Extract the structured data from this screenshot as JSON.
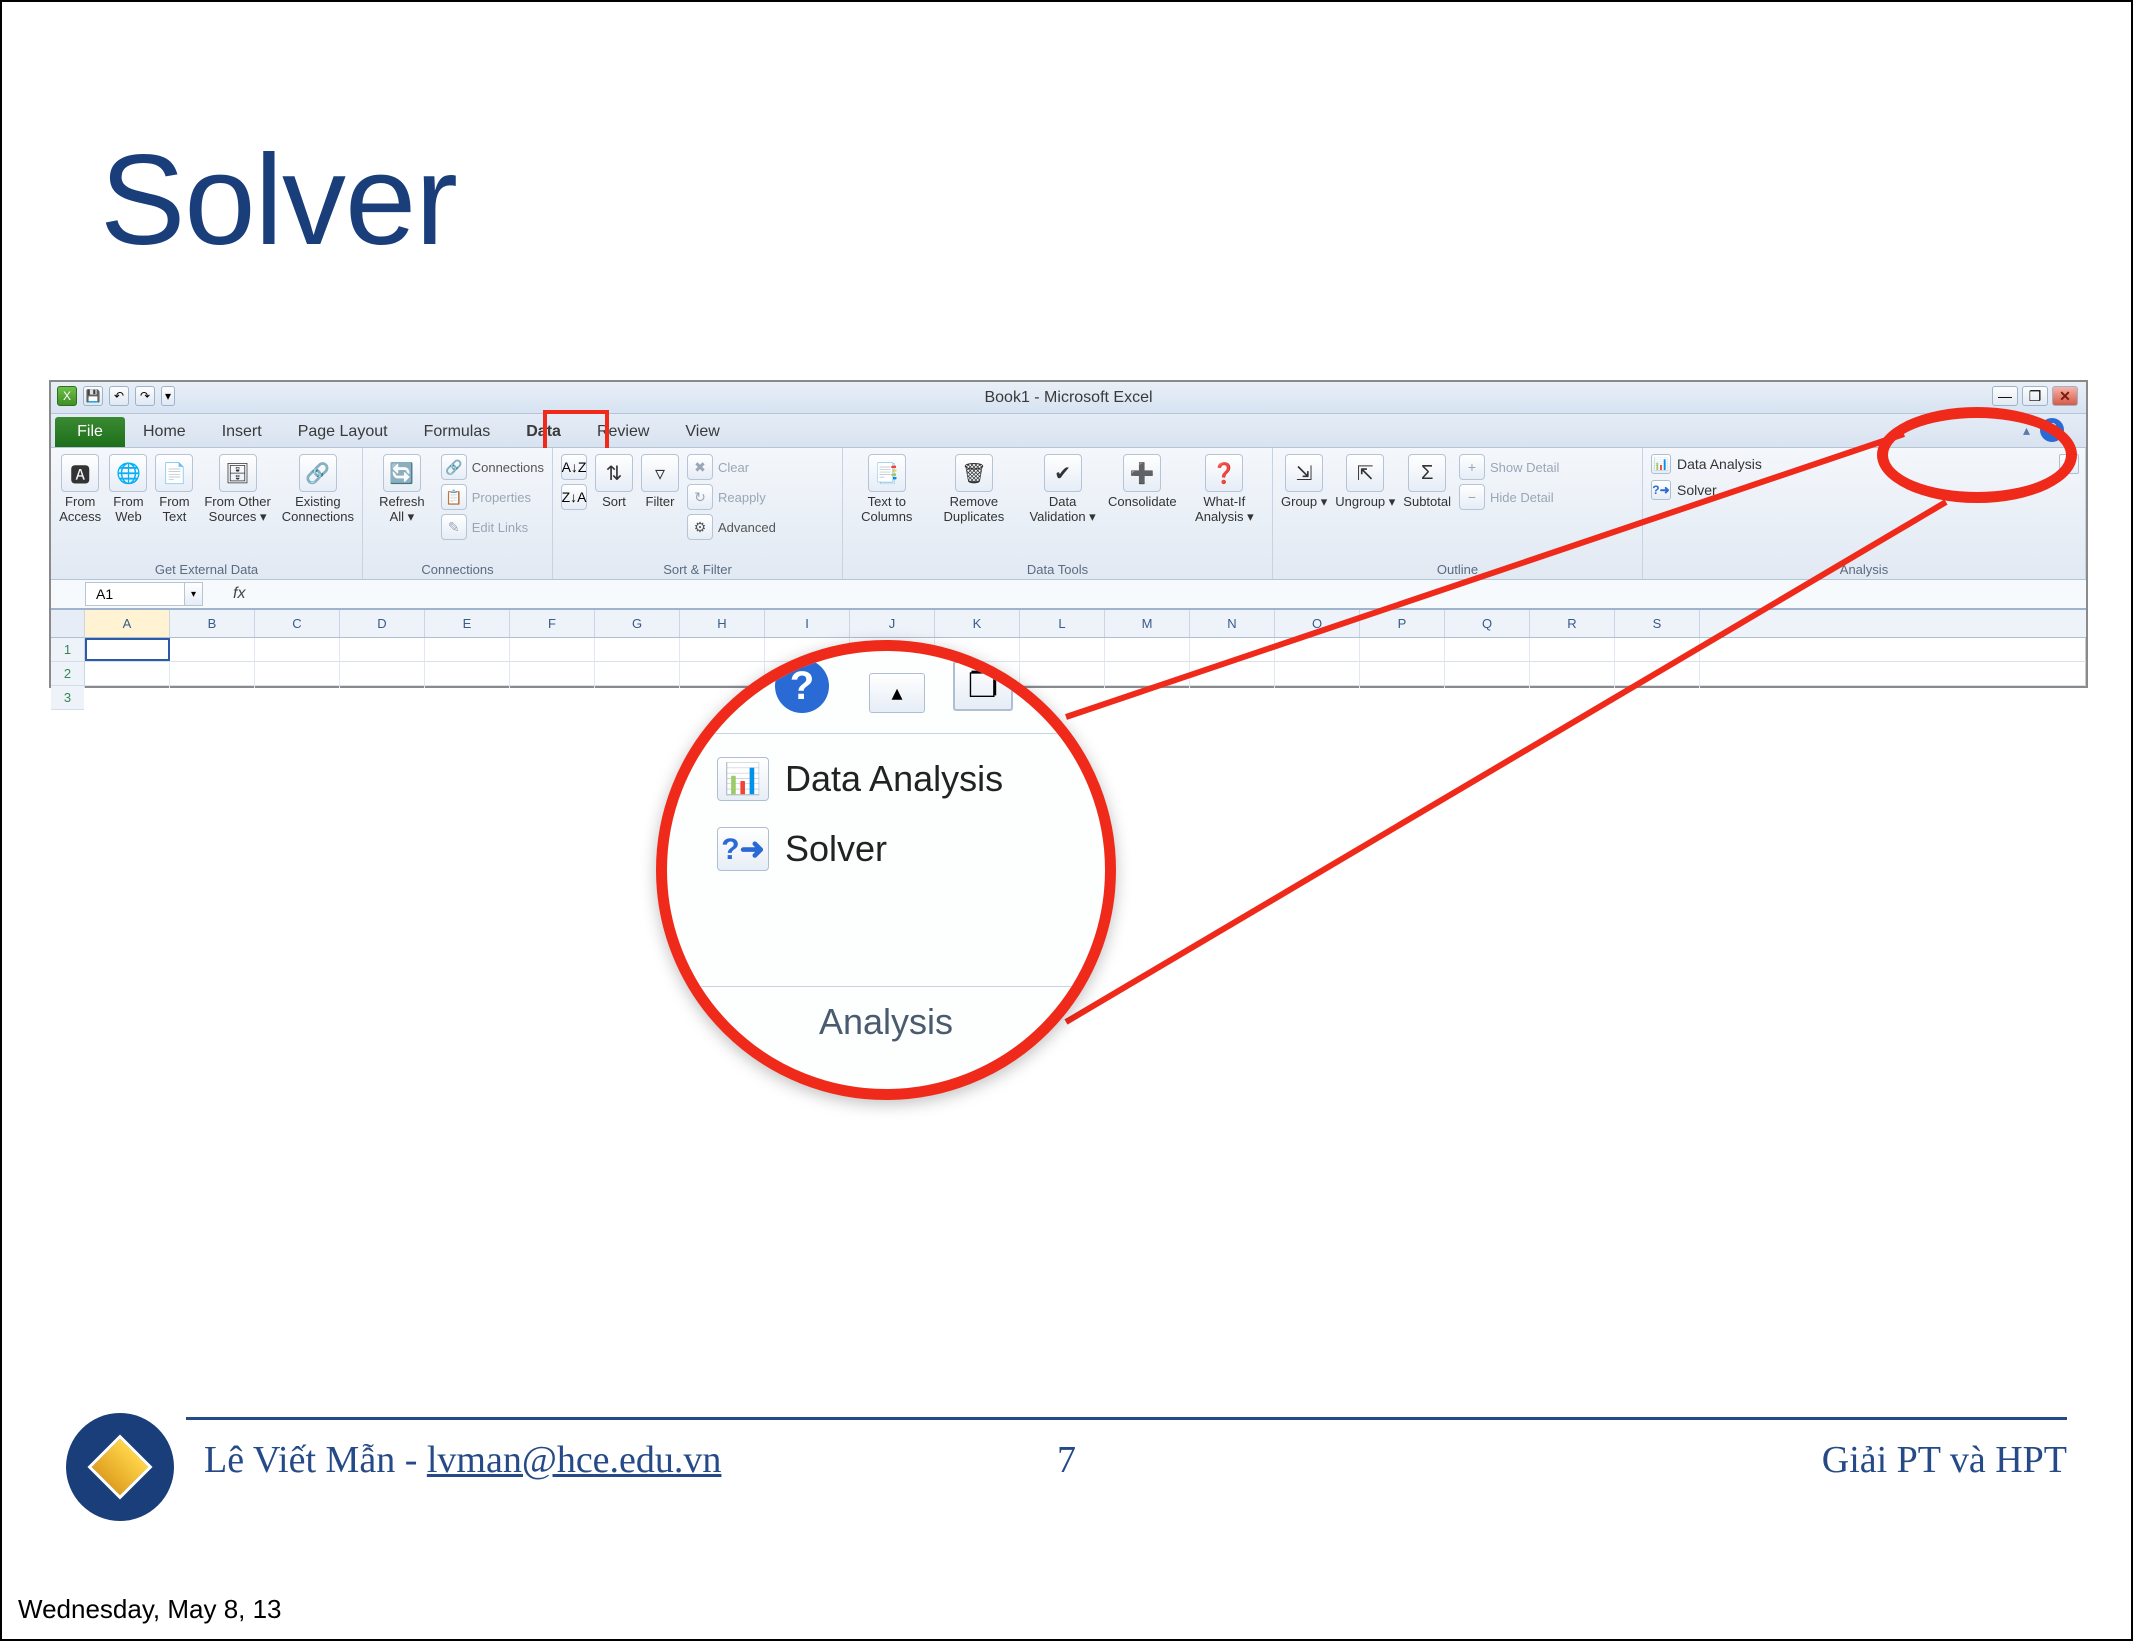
{
  "slide": {
    "title": "Solver",
    "page_number": "7",
    "author_name": "Lê Viết Mẫn",
    "author_email": "lvman@hce.edu.vn",
    "course": "Giải PT và HPT",
    "date": "Wednesday, May 8, 13"
  },
  "excel": {
    "title": "Book1 - Microsoft Excel",
    "qat": {
      "save": "💾",
      "undo": "↶",
      "redo": "↷"
    },
    "window_controls": {
      "minimize": "—",
      "restore": "❐",
      "close": "✕"
    },
    "tabs": {
      "file": "File",
      "items": [
        "Home",
        "Insert",
        "Page Layout",
        "Formulas",
        "Data",
        "Review",
        "View"
      ],
      "active": "Data"
    },
    "ribbon": {
      "get_external_data": {
        "label": "Get External Data",
        "buttons": [
          {
            "label": "From Access"
          },
          {
            "label": "From Web"
          },
          {
            "label": "From Text"
          },
          {
            "label": "From Other Sources ▾"
          },
          {
            "label": "Existing Connections"
          }
        ]
      },
      "connections": {
        "label": "Connections",
        "refresh": "Refresh All ▾",
        "items": [
          "Connections",
          "Properties",
          "Edit Links"
        ]
      },
      "sort_filter": {
        "label": "Sort & Filter",
        "sort_asc": "A↓Z",
        "sort_desc": "Z↓A",
        "sort": "Sort",
        "filter": "Filter",
        "clear": "Clear",
        "reapply": "Reapply",
        "advanced": "Advanced"
      },
      "data_tools": {
        "label": "Data Tools",
        "buttons": [
          "Text to Columns",
          "Remove Duplicates",
          "Data Validation ▾",
          "Consolidate",
          "What-If Analysis ▾"
        ]
      },
      "outline": {
        "label": "Outline",
        "buttons": [
          "Group ▾",
          "Ungroup ▾",
          "Subtotal"
        ],
        "show_detail": "Show Detail",
        "hide_detail": "Hide Detail"
      },
      "analysis": {
        "label": "Analysis",
        "data_analysis": "Data Analysis",
        "solver": "Solver"
      }
    },
    "name_box": "A1",
    "fx": "fx",
    "columns": [
      "A",
      "B",
      "C",
      "D",
      "E",
      "F",
      "G",
      "H",
      "I",
      "J",
      "K",
      "L",
      "M",
      "N",
      "O",
      "P",
      "Q",
      "R",
      "S"
    ],
    "rows": [
      "1",
      "2",
      "3"
    ]
  },
  "zoom": {
    "data_analysis": "Data Analysis",
    "solver": "Solver",
    "group": "Analysis"
  }
}
